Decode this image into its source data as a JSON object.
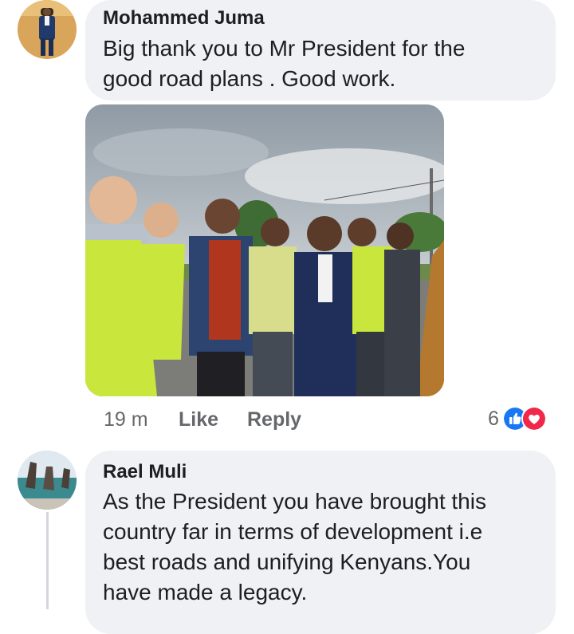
{
  "comments": [
    {
      "author": "Mohammed Juma",
      "text": "Big thank you to Mr President for the good road plans . Good work.",
      "time": "19 m",
      "like_label": "Like",
      "reply_label": "Reply",
      "reaction_count": "6",
      "reaction_icons": [
        "like-icon",
        "love-icon"
      ]
    },
    {
      "author": "Rael Muli",
      "text": "As the President you have brought this country far in terms of development i.e best roads and unifying Kenyans.You have made a legacy."
    }
  ],
  "colors": {
    "bubble": "#eff1f4",
    "like_blue": "#1877f2",
    "love_red": "#f02849",
    "meta_gray": "#65676b"
  }
}
